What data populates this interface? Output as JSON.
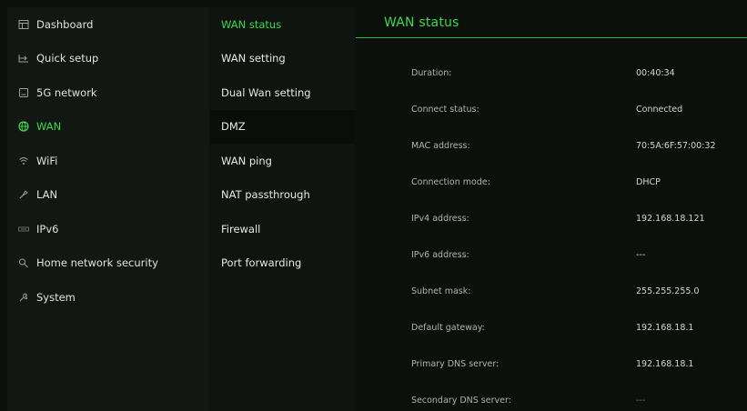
{
  "sidebar": {
    "items": [
      {
        "label": "Dashboard",
        "icon": "dashboard-icon"
      },
      {
        "label": "Quick setup",
        "icon": "quick-setup-icon"
      },
      {
        "label": "5G network",
        "icon": "network-icon"
      },
      {
        "label": "WAN",
        "icon": "globe-icon"
      },
      {
        "label": "WiFi",
        "icon": "wifi-icon"
      },
      {
        "label": "LAN",
        "icon": "lan-icon"
      },
      {
        "label": "IPv6",
        "icon": "ipv6-icon"
      },
      {
        "label": "Home network security",
        "icon": "security-icon"
      },
      {
        "label": "System",
        "icon": "system-icon"
      }
    ],
    "active": "WAN"
  },
  "subnav": {
    "items": [
      {
        "label": "WAN status"
      },
      {
        "label": "WAN setting"
      },
      {
        "label": "Dual Wan setting"
      },
      {
        "label": "DMZ"
      },
      {
        "label": "WAN ping"
      },
      {
        "label": "NAT passthrough"
      },
      {
        "label": "Firewall"
      },
      {
        "label": "Port forwarding"
      }
    ],
    "active": "WAN status"
  },
  "main": {
    "title": "WAN status",
    "rows": [
      {
        "label": "Duration:",
        "value": "00:40:34"
      },
      {
        "label": "Connect status:",
        "value": "Connected"
      },
      {
        "label": "MAC address:",
        "value": "70:5A:6F:57:00:32"
      },
      {
        "label": "Connection mode:",
        "value": "DHCP"
      },
      {
        "label": "IPv4 address:",
        "value": "192.168.18.121"
      },
      {
        "label": "IPv6 address:",
        "value": "---"
      },
      {
        "label": "Subnet mask:",
        "value": "255.255.255.0"
      },
      {
        "label": "Default gateway:",
        "value": "192.168.18.1"
      },
      {
        "label": "Primary DNS server:",
        "value": "192.168.18.1"
      },
      {
        "label": "Secondary DNS server:",
        "value": "---"
      }
    ]
  },
  "colors": {
    "accent": "#3bd94a",
    "divider": "#1fbf3a",
    "background": "#0b100d"
  }
}
